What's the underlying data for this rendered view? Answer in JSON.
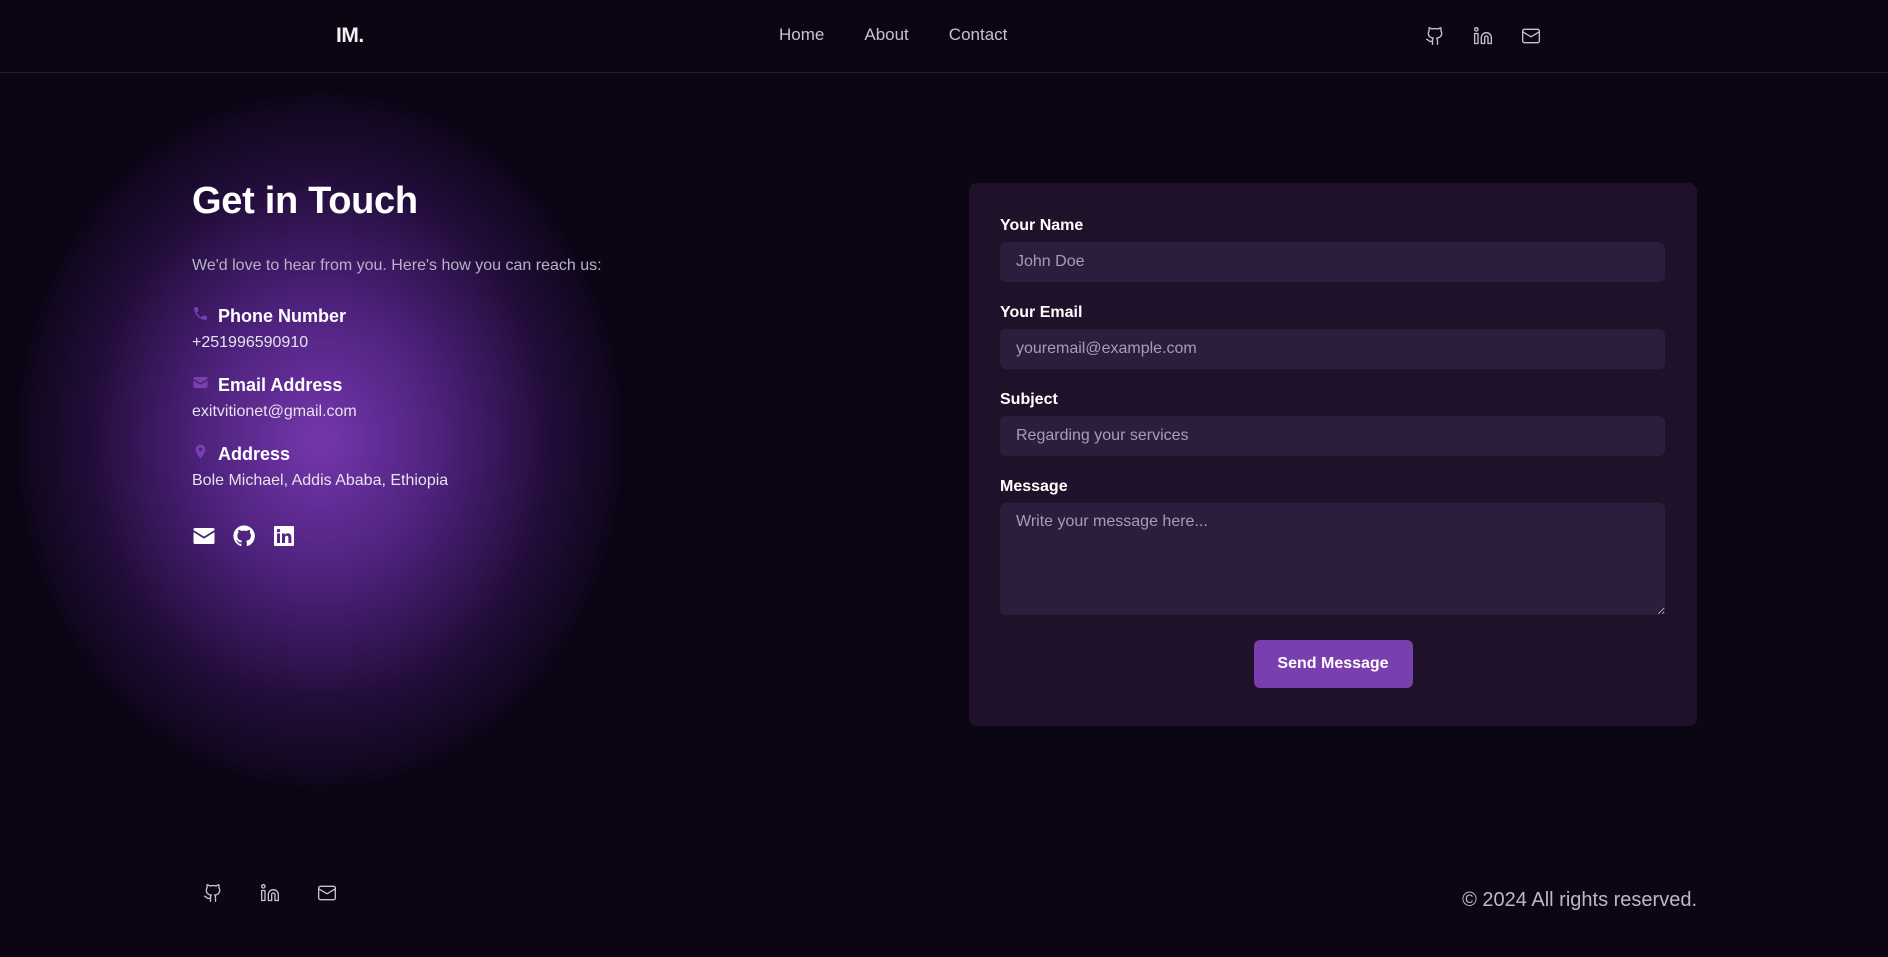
{
  "nav": {
    "logo": "IM.",
    "links": [
      "Home",
      "About",
      "Contact"
    ],
    "icons": [
      "github-icon",
      "linkedin-icon",
      "mail-icon"
    ]
  },
  "contact": {
    "heading": "Get in Touch",
    "intro": "We'd love to hear from you. Here's how you can reach us:",
    "phone": {
      "label": "Phone Number",
      "value": "+251996590910"
    },
    "email": {
      "label": "Email Address",
      "value": "exitvitionet@gmail.com"
    },
    "address": {
      "label": "Address",
      "value": "Bole Michael, Addis Ababa, Ethiopia"
    },
    "social_icons": [
      "envelope-icon",
      "github-icon",
      "linkedin-icon"
    ]
  },
  "form": {
    "name": {
      "label": "Your Name",
      "placeholder": "John Doe"
    },
    "email": {
      "label": "Your Email",
      "placeholder": "youremail@example.com"
    },
    "subject": {
      "label": "Subject",
      "placeholder": "Regarding your services"
    },
    "message": {
      "label": "Message",
      "placeholder": "Write your message here..."
    },
    "submit_label": "Send Message"
  },
  "footer": {
    "icons": [
      "github-icon",
      "linkedin-icon",
      "mail-icon"
    ],
    "copyright": "© 2024 All rights reserved."
  },
  "colors": {
    "background": "#0b0514",
    "card": "#1f1129",
    "input": "#2c1d3d",
    "accent": "#7a3fae"
  }
}
